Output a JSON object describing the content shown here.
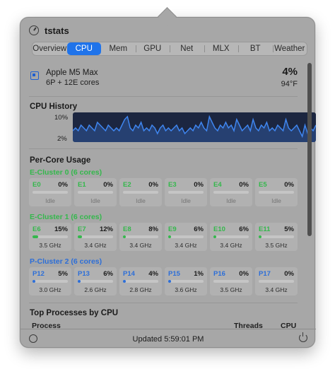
{
  "app": {
    "title": "tstats"
  },
  "tabs": [
    "Overview",
    "CPU",
    "Mem",
    "GPU",
    "Net",
    "MLX",
    "BT",
    "Weather"
  ],
  "active_tab": "CPU",
  "cpu": {
    "model": "Apple M5 Max",
    "cores": "6P + 12E cores",
    "usage": "4%",
    "temp": "94°F"
  },
  "history": {
    "title": "CPU History",
    "top_label": "10%",
    "bottom_label": "2%",
    "values": [
      5,
      6,
      5,
      7,
      6,
      5,
      7,
      6,
      5,
      8,
      7,
      6,
      5,
      7,
      6,
      5,
      6,
      5,
      7,
      9,
      10,
      6,
      5,
      7,
      6,
      8,
      5,
      6,
      5,
      7,
      6,
      4,
      6,
      7,
      5,
      6,
      5,
      6,
      7,
      5,
      6,
      4,
      5,
      6,
      5,
      7,
      6,
      8,
      6,
      5,
      10,
      8,
      6,
      5,
      7,
      6,
      8,
      6,
      7,
      5,
      9,
      7,
      5,
      6,
      7,
      5,
      9,
      6,
      5,
      7,
      6,
      8,
      5,
      6,
      5,
      7,
      6,
      5,
      9,
      6,
      5,
      6,
      7,
      5,
      3,
      7,
      4,
      6,
      5,
      7
    ]
  },
  "percore": {
    "title": "Per-Core Usage",
    "clusters": [
      {
        "title": "E-Cluster 0 (6 cores)",
        "kind": "e",
        "cores": [
          {
            "name": "E0",
            "pct": "0%",
            "frac": 0,
            "foot": "Idle"
          },
          {
            "name": "E1",
            "pct": "0%",
            "frac": 0,
            "foot": "Idle"
          },
          {
            "name": "E2",
            "pct": "0%",
            "frac": 0,
            "foot": "Idle"
          },
          {
            "name": "E3",
            "pct": "0%",
            "frac": 0,
            "foot": "Idle"
          },
          {
            "name": "E4",
            "pct": "0%",
            "frac": 0,
            "foot": "Idle"
          },
          {
            "name": "E5",
            "pct": "0%",
            "frac": 0,
            "foot": "Idle"
          }
        ]
      },
      {
        "title": "E-Cluster 1 (6 cores)",
        "kind": "e",
        "cores": [
          {
            "name": "E6",
            "pct": "15%",
            "frac": 0.15,
            "foot": "3.5 GHz"
          },
          {
            "name": "E7",
            "pct": "12%",
            "frac": 0.12,
            "foot": "3.4 GHz"
          },
          {
            "name": "E8",
            "pct": "8%",
            "frac": 0.08,
            "foot": "3.4 GHz"
          },
          {
            "name": "E9",
            "pct": "6%",
            "frac": 0.06,
            "foot": "3.4 GHz"
          },
          {
            "name": "E10",
            "pct": "6%",
            "frac": 0.06,
            "foot": "3.4 GHz"
          },
          {
            "name": "E11",
            "pct": "5%",
            "frac": 0.05,
            "foot": "3.5 GHz"
          }
        ]
      },
      {
        "title": "P-Cluster 2 (6 cores)",
        "kind": "p",
        "cores": [
          {
            "name": "P12",
            "pct": "5%",
            "frac": 0.05,
            "foot": "3.0 GHz"
          },
          {
            "name": "P13",
            "pct": "6%",
            "frac": 0.06,
            "foot": "2.6 GHz"
          },
          {
            "name": "P14",
            "pct": "4%",
            "frac": 0.04,
            "foot": "2.8 GHz"
          },
          {
            "name": "P15",
            "pct": "1%",
            "frac": 0.01,
            "foot": "3.6 GHz"
          },
          {
            "name": "P16",
            "pct": "0%",
            "frac": 0,
            "foot": "3.5 GHz"
          },
          {
            "name": "P17",
            "pct": "0%",
            "frac": 0,
            "foot": "3.4 GHz"
          }
        ]
      }
    ]
  },
  "processes": {
    "title": "Top Processes by CPU",
    "col_process": "Process",
    "col_threads": "Threads",
    "col_cpu": "CPU"
  },
  "footer": {
    "updated": "Updated 5:59:01 PM"
  },
  "colors": {
    "accent": "#1f73ea",
    "e_core": "#34b84c",
    "p_core": "#2c6ed8",
    "graph_line": "#3f86f0",
    "graph_bg": "#1c2640"
  }
}
